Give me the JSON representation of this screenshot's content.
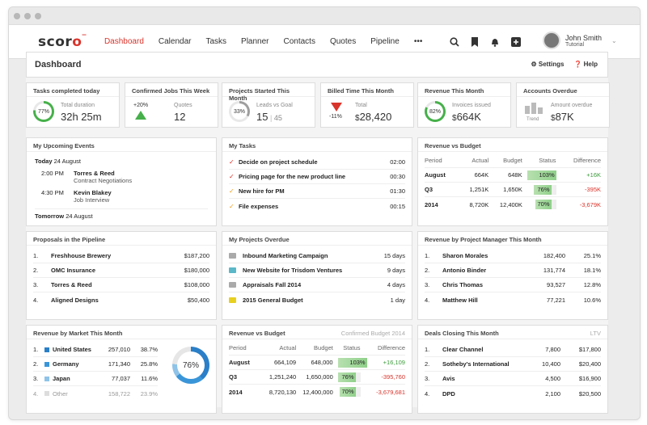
{
  "app": {
    "logo": "scoro",
    "nav": [
      "Dashboard",
      "Calendar",
      "Tasks",
      "Planner",
      "Contacts",
      "Quotes",
      "Pipeline",
      "•••"
    ],
    "user_name": "John Smith",
    "user_sub": "Tutorial"
  },
  "dashboard": {
    "title": "Dashboard",
    "settings": "Settings",
    "help": "Help"
  },
  "kpis": [
    {
      "title": "Tasks completed today",
      "ring": "77%",
      "pct": 77,
      "label": "Total duration",
      "value": "32h 25m"
    },
    {
      "title": "Confirmed Jobs This Week",
      "delta": "+20%",
      "label": "Quotes",
      "value": "12"
    },
    {
      "title": "Projects Started This Month",
      "ring": "33%",
      "pct": 33,
      "label": "Leads vs Goal",
      "value": "15",
      "sub": "45"
    },
    {
      "title": "Billed Time This Month",
      "delta": "-11%",
      "label": "Total",
      "currency": "$",
      "value": "28,420"
    },
    {
      "title": "Revenue This Month",
      "ring": "82%",
      "pct": 82,
      "label": "Invoices issued",
      "currency": "$",
      "value": "664K"
    },
    {
      "title": "Accounts Overdue",
      "trend": "Trend",
      "label": "Amount overdue",
      "currency": "$",
      "value": "87K"
    }
  ],
  "events": {
    "title": "My Upcoming Events",
    "today": "Today",
    "today_date": "24 August",
    "items": [
      {
        "time": "2:00 PM",
        "name": "Torres & Reed",
        "desc": "Contract Negotiations"
      },
      {
        "time": "4:30 PM",
        "name": "Kevin Blakey",
        "desc": "Job Interview"
      }
    ],
    "tomorrow": "Tomorrow",
    "tomorrow_date": "24 August"
  },
  "tasks": {
    "title": "My Tasks",
    "items": [
      {
        "name": "Decide on project schedule",
        "time": "02:00",
        "color": "#d9342b"
      },
      {
        "name": "Pricing page for the new product line",
        "time": "00:30",
        "color": "#d9342b"
      },
      {
        "name": "New hire for PM",
        "time": "01:30",
        "color": "#f0a020"
      },
      {
        "name": "File expenses",
        "time": "00:15",
        "color": "#f0a020"
      }
    ]
  },
  "rvb1": {
    "title": "Revenue vs Budget",
    "headers": [
      "Period",
      "Actual",
      "Budget",
      "Status",
      "Difference"
    ],
    "rows": [
      {
        "p": "August",
        "a": "664K",
        "b": "648K",
        "s": "103%",
        "pct": 100,
        "d": "+16K",
        "pos": true
      },
      {
        "p": "Q3",
        "a": "1,251K",
        "b": "1,650K",
        "s": "76%",
        "pct": 76,
        "d": "-395K",
        "pos": false
      },
      {
        "p": "2014",
        "a": "8,720K",
        "b": "12,400K",
        "s": "70%",
        "pct": 70,
        "d": "-3,679K",
        "pos": false
      }
    ]
  },
  "pipeline": {
    "title": "Proposals in the Pipeline",
    "rows": [
      {
        "n": "1.",
        "name": "Freshhouse Brewery",
        "v": "$187,200"
      },
      {
        "n": "2.",
        "name": "OMC Insurance",
        "v": "$180,000"
      },
      {
        "n": "3.",
        "name": "Torres & Reed",
        "v": "$108,000"
      },
      {
        "n": "4.",
        "name": "Aligned Designs",
        "v": "$50,400"
      }
    ]
  },
  "overdue": {
    "title": "My Projects Overdue",
    "rows": [
      {
        "name": "Inbound Marketing Campaign",
        "v": "15 days",
        "color": "#aaa"
      },
      {
        "name": "New Website for Trisdom Ventures",
        "v": "9 days",
        "color": "#5bb8c8"
      },
      {
        "name": "Appraisals Fall 2014",
        "v": "4 days",
        "color": "#aaa"
      },
      {
        "name": "2015 General Budget",
        "v": "1 day",
        "color": "#e8d020"
      }
    ]
  },
  "rbpm": {
    "title": "Revenue by Project Manager This Month",
    "rows": [
      {
        "n": "1.",
        "name": "Sharon Morales",
        "v": "182,400",
        "p": "25.1%"
      },
      {
        "n": "2.",
        "name": "Antonio Binder",
        "v": "131,774",
        "p": "18.1%"
      },
      {
        "n": "3.",
        "name": "Chris Thomas",
        "v": "93,527",
        "p": "12.8%"
      },
      {
        "n": "4.",
        "name": "Matthew Hill",
        "v": "77,221",
        "p": "10.6%"
      }
    ]
  },
  "market": {
    "title": "Revenue by Market This Month",
    "donut": "76%",
    "rows": [
      {
        "n": "1.",
        "name": "United States",
        "v": "257,010",
        "p": "38.7%",
        "color": "#2a7fc8"
      },
      {
        "n": "2.",
        "name": "Germany",
        "v": "171,340",
        "p": "25.8%",
        "color": "#3a95d8"
      },
      {
        "n": "3.",
        "name": "Japan",
        "v": "77,037",
        "p": "11.6%",
        "color": "#8fc3e8"
      },
      {
        "n": "4.",
        "name": "Other",
        "v": "158,722",
        "p": "23.9%",
        "color": "#ddd"
      }
    ]
  },
  "rvb2": {
    "title": "Revenue vs Budget",
    "subtitle": "Confirmed Budget 2014",
    "headers": [
      "Period",
      "Actual",
      "Budget",
      "Status",
      "Difference"
    ],
    "rows": [
      {
        "p": "August",
        "a": "664,109",
        "b": "648,000",
        "s": "103%",
        "pct": 100,
        "d": "+16,109",
        "pos": true
      },
      {
        "p": "Q3",
        "a": "1,251,240",
        "b": "1,650,000",
        "s": "76%",
        "pct": 76,
        "d": "-395,760",
        "pos": false
      },
      {
        "p": "2014",
        "a": "8,720,130",
        "b": "12,400,000",
        "s": "70%",
        "pct": 70,
        "d": "-3,679,681",
        "pos": false
      }
    ]
  },
  "deals": {
    "title": "Deals Closing This Month",
    "subtitle": "LTV",
    "rows": [
      {
        "n": "1.",
        "name": "Clear Channel",
        "v": "7,800",
        "ltv": "$17,800"
      },
      {
        "n": "2.",
        "name": "Sotheby's International",
        "v": "10,400",
        "ltv": "$20,400"
      },
      {
        "n": "3.",
        "name": "Avis",
        "v": "4,500",
        "ltv": "$16,900"
      },
      {
        "n": "4.",
        "name": "DPD",
        "v": "2,100",
        "ltv": "$20,500"
      }
    ]
  }
}
